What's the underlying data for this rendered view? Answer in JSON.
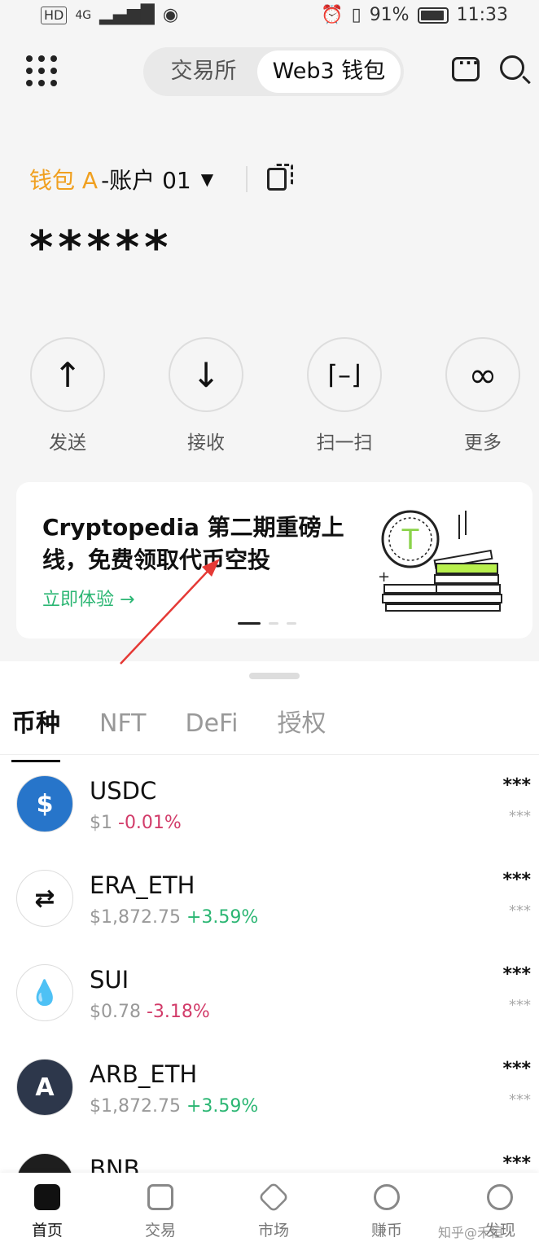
{
  "status_bar": {
    "network": "HD",
    "signal": "4G",
    "battery": "91%",
    "time": "11:33"
  },
  "header": {
    "tabs": [
      "交易所",
      "Web3 钱包"
    ],
    "active_tab": 1
  },
  "wallet": {
    "name": "钱包 A",
    "account": "-账户 01",
    "balance": "*****"
  },
  "actions": [
    {
      "label": "发送",
      "icon": "arrow-up-icon"
    },
    {
      "label": "接收",
      "icon": "arrow-down-icon"
    },
    {
      "label": "扫一扫",
      "icon": "scan-icon"
    },
    {
      "label": "更多",
      "icon": "infinity-icon"
    }
  ],
  "banner": {
    "title": "Cryptopedia 第二期重磅上线，免费领取代币空投",
    "cta": "立即体验 →"
  },
  "asset_tabs": [
    "币种",
    "NFT",
    "DeFi",
    "授权"
  ],
  "tokens": [
    {
      "symbol": "USDC",
      "price": "$1",
      "change": "-0.01%",
      "balance": "***",
      "value": "***"
    },
    {
      "symbol": "ERA_ETH",
      "price": "$1,872.75",
      "change": "+3.59%",
      "balance": "***",
      "value": "***"
    },
    {
      "symbol": "SUI",
      "price": "$0.78",
      "change": "-3.18%",
      "balance": "***",
      "value": "***"
    },
    {
      "symbol": "ARB_ETH",
      "price": "$1,872.75",
      "change": "+3.59%",
      "balance": "***",
      "value": "***"
    },
    {
      "symbol": "BNB",
      "balance": "***"
    }
  ],
  "bottom_nav": [
    "首页",
    "交易",
    "市场",
    "赚币",
    "发现"
  ],
  "watermark": "知乎@禾恒"
}
